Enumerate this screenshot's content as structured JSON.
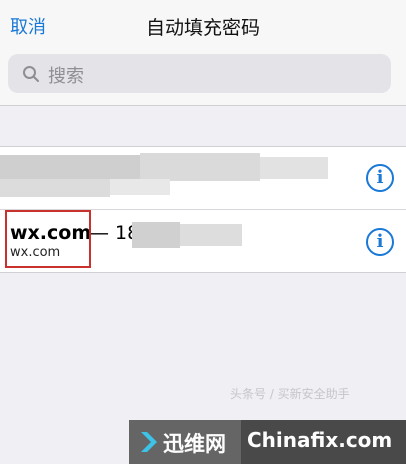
{
  "nav": {
    "cancel_label": "取消",
    "title": "自动填充密码"
  },
  "search": {
    "placeholder": "搜索"
  },
  "list": {
    "rows": [
      {
        "site": "",
        "username": "",
        "subtitle": "",
        "redacted": true,
        "info_icon": "info-circle-icon"
      },
      {
        "site": "wx.com",
        "username_prefix": "— 18",
        "subtitle": "wx.com",
        "redacted_username": true,
        "highlighted": true,
        "info_icon": "info-circle-icon"
      }
    ]
  },
  "watermark": {
    "brand": "迅维网",
    "site": "Chinafix.com",
    "gray_text": "头条号 / 买新安全助手"
  },
  "colors": {
    "accent": "#1a78d6",
    "highlight": "#c8312c",
    "background": "#efeff4"
  }
}
